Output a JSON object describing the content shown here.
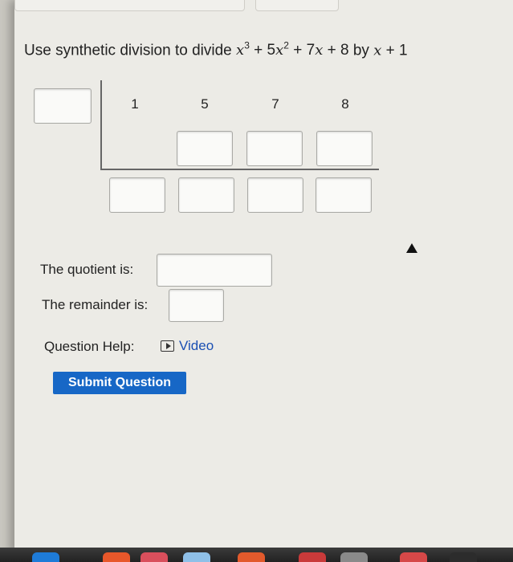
{
  "question": {
    "prefix": "Use synthetic division to divide",
    "by_word": "by"
  },
  "division": {
    "coefficients": [
      "1",
      "5",
      "7",
      "8"
    ]
  },
  "quotient_label": "The quotient is:",
  "remainder_label": "The remainder is:",
  "help": {
    "label": "Question Help:",
    "video_label": "Video"
  },
  "submit_label": "Submit Question",
  "colors": {
    "accent": "#1767c6",
    "link": "#1a4fb3",
    "page_bg": "#ecebe6"
  }
}
